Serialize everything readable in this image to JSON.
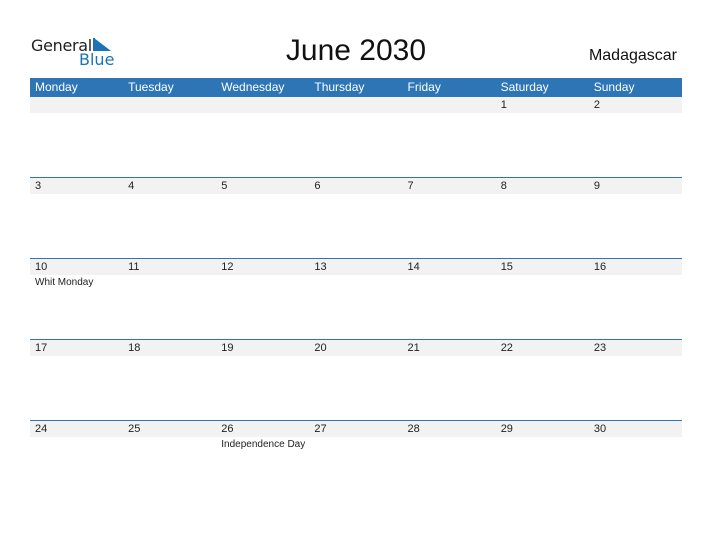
{
  "logo": {
    "line1": "General",
    "line2": "Blue"
  },
  "title": "June 2030",
  "country": "Madagascar",
  "colors": {
    "accent": "#2e75b6",
    "logo_blue": "#1a73b8",
    "row_bg": "#f2f2f2"
  },
  "weekdays": [
    "Monday",
    "Tuesday",
    "Wednesday",
    "Thursday",
    "Friday",
    "Saturday",
    "Sunday"
  ],
  "weeks": [
    [
      {
        "d": ""
      },
      {
        "d": ""
      },
      {
        "d": ""
      },
      {
        "d": ""
      },
      {
        "d": ""
      },
      {
        "d": "1"
      },
      {
        "d": "2"
      }
    ],
    [
      {
        "d": "3"
      },
      {
        "d": "4"
      },
      {
        "d": "5"
      },
      {
        "d": "6"
      },
      {
        "d": "7"
      },
      {
        "d": "8"
      },
      {
        "d": "9"
      }
    ],
    [
      {
        "d": "10",
        "e": "Whit Monday"
      },
      {
        "d": "11"
      },
      {
        "d": "12"
      },
      {
        "d": "13"
      },
      {
        "d": "14"
      },
      {
        "d": "15"
      },
      {
        "d": "16"
      }
    ],
    [
      {
        "d": "17"
      },
      {
        "d": "18"
      },
      {
        "d": "19"
      },
      {
        "d": "20"
      },
      {
        "d": "21"
      },
      {
        "d": "22"
      },
      {
        "d": "23"
      }
    ],
    [
      {
        "d": "24"
      },
      {
        "d": "25"
      },
      {
        "d": "26",
        "e": "Independence Day"
      },
      {
        "d": "27"
      },
      {
        "d": "28"
      },
      {
        "d": "29"
      },
      {
        "d": "30"
      }
    ]
  ]
}
